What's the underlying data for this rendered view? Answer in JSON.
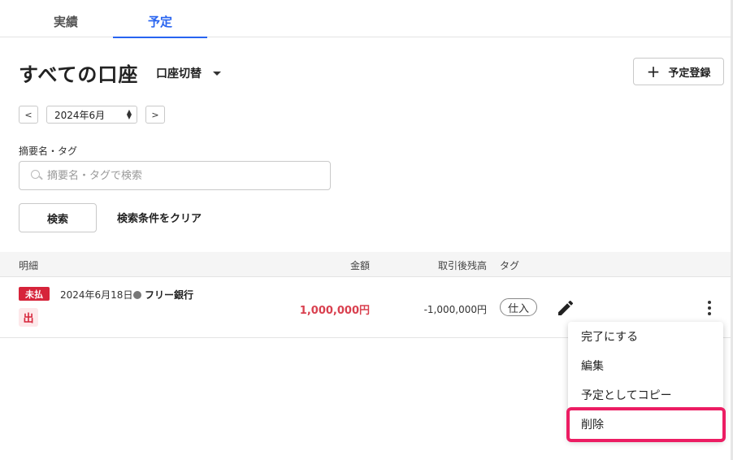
{
  "tabs": [
    {
      "label": "実績"
    },
    {
      "label": "予定"
    }
  ],
  "header": {
    "title": "すべての口座",
    "account_switch_label": "口座切替",
    "add_button_label": "予定登録"
  },
  "month_nav": {
    "prev_label": "<",
    "next_label": ">",
    "selected_month": "2024年6月"
  },
  "filter": {
    "label": "摘要名・タグ",
    "placeholder": "摘要名・タグで検索",
    "value": "",
    "search_button_label": "検索",
    "clear_button_label": "検索条件をクリア"
  },
  "table": {
    "headers": {
      "detail": "明細",
      "amount": "金額",
      "balance": "取引後残高",
      "tag": "タグ"
    },
    "rows": [
      {
        "status_badge": "未払",
        "type_badge": "出",
        "date": "2024年6月18日",
        "bank": "フリー銀行",
        "amount": "1,000,000円",
        "balance": "-1,000,000円",
        "tag": "仕入"
      }
    ]
  },
  "context_menu": {
    "items": [
      {
        "label": "完了にする"
      },
      {
        "label": "編集"
      },
      {
        "label": "予定としてコピー"
      },
      {
        "label": "削除"
      }
    ]
  },
  "colors": {
    "accent": "#2864f0",
    "unpaid_badge": "#d6243a",
    "amount_negative": "#d9404f",
    "highlight": "#ec1d63"
  }
}
